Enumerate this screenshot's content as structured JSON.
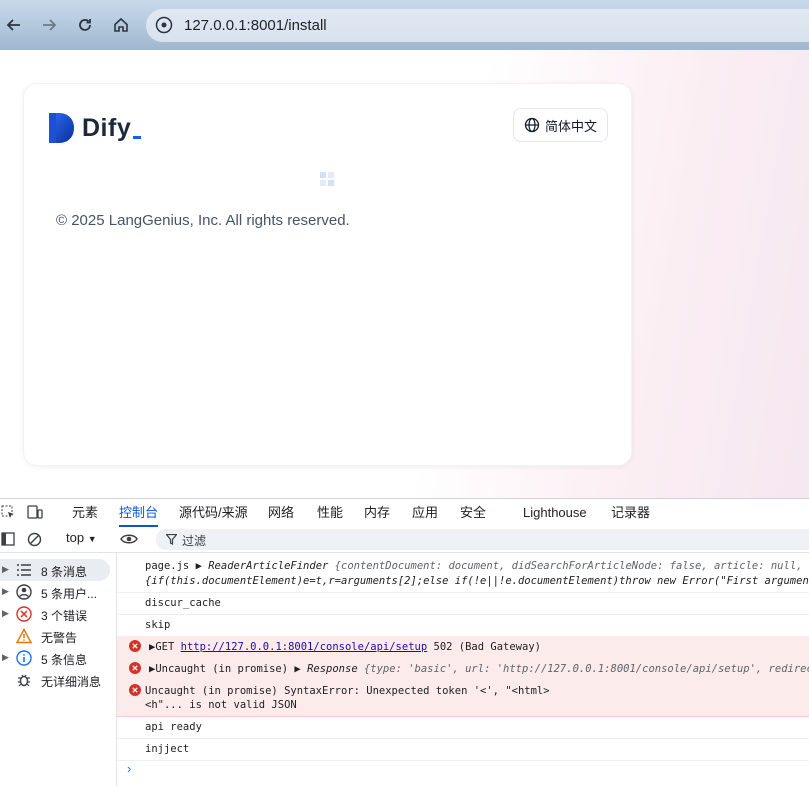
{
  "browser": {
    "url": "127.0.0.1:8001/install"
  },
  "page": {
    "logo_text": "Dify",
    "language_button": "简体中文",
    "copyright": "© 2025 LangGenius, Inc. All rights reserved."
  },
  "devtools": {
    "tabs": [
      "元素",
      "控制台",
      "源代码/来源",
      "网络",
      "性能",
      "内存",
      "应用",
      "安全",
      "Lighthouse",
      "记录器"
    ],
    "active_tab": "控制台",
    "context": "top",
    "filter_label": "过滤",
    "sidebar": [
      {
        "label": "8 条消息",
        "icon": "list-icon"
      },
      {
        "label": "5 条用户...",
        "icon": "user-icon"
      },
      {
        "label": "3 个错误",
        "icon": "error-icon"
      },
      {
        "label": "无警告",
        "icon": "warning-icon"
      },
      {
        "label": "5 条信息",
        "icon": "info-icon"
      },
      {
        "label": "无详细消息",
        "icon": "bug-icon"
      }
    ],
    "messages": {
      "m1_source": "page.js",
      "m1_obj": "ReaderArticleFinder",
      "m1_props": "{contentDocument: document, didSearchForArticleNode: false, article: null, didS",
      "m1_line2": "{if(this.documentElement)e=t,r=arguments[2];else if(!e||!e.documentElement)throw new Error(\"First argument to l",
      "m2": "discur_cache",
      "m3": "skip",
      "m4_method": "GET",
      "m4_url": "http://127.0.0.1:8001/console/api/setup",
      "m4_status": "502 (Bad Gateway)",
      "m5_prefix": "Uncaught (in promise)",
      "m5_obj": "Response",
      "m5_props": "{type: 'basic', url: 'http://127.0.0.1:8001/console/api/setup', redirected",
      "m6_line1": "Uncaught (in promise) SyntaxError: Unexpected token '<', \"<html>",
      "m6_line2": "<h\"... is not valid JSON",
      "m7": "api ready",
      "m8": "injject"
    }
  }
}
